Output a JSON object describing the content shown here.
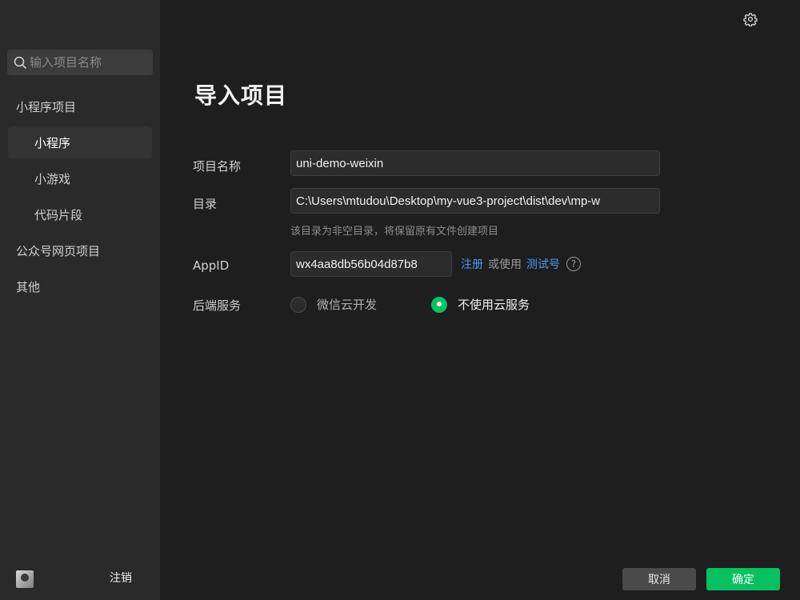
{
  "sidebar": {
    "search_placeholder": "输入项目名称",
    "items": [
      {
        "label": "小程序项目"
      },
      {
        "label": "小程序"
      },
      {
        "label": "小游戏"
      },
      {
        "label": "代码片段"
      },
      {
        "label": "公众号网页项目"
      },
      {
        "label": "其他"
      }
    ],
    "logout_label": "注销"
  },
  "main": {
    "title": "导入项目",
    "project_name_label": "项目名称",
    "project_name_value": "uni-demo-weixin",
    "directory_label": "目录",
    "directory_value": "C:\\Users\\mtudou\\Desktop\\my-vue3-project\\dist\\dev\\mp-w",
    "directory_hint": "该目录为非空目录，将保留原有文件创建项目",
    "appid_label": "AppID",
    "appid_value": "wx4aa8db56b04d87b8",
    "register_link": "注册",
    "or_use_text": "或使用",
    "test_account_link": "测试号",
    "help_symbol": "?",
    "backend_label": "后端服务",
    "backend_options": [
      {
        "label": "微信云开发",
        "checked": false
      },
      {
        "label": "不使用云服务",
        "checked": true
      }
    ]
  },
  "footer": {
    "cancel_label": "取消",
    "confirm_label": "确定"
  },
  "colors": {
    "accent": "#07c160",
    "link": "#4a9bf0",
    "background": "#1e1e1e",
    "sidebar": "#2a2a2a"
  }
}
